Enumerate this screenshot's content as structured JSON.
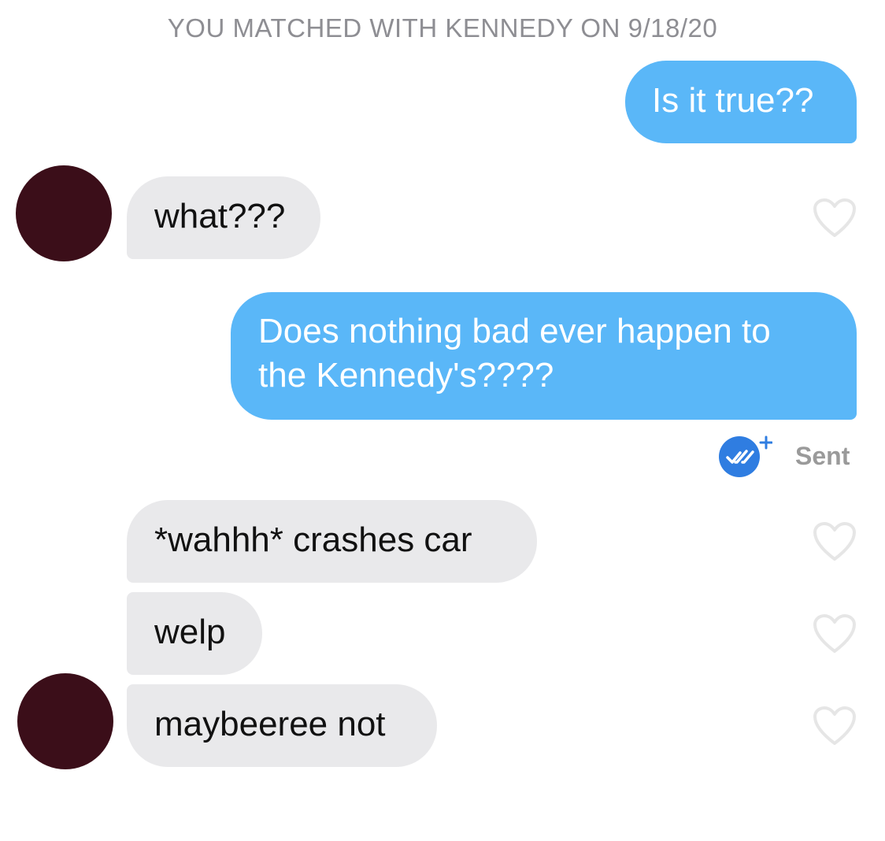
{
  "header": {
    "match_text": "YOU MATCHED WITH KENNEDY ON 9/18/20"
  },
  "messages": [
    {
      "direction": "outgoing",
      "text": "Is it true??"
    },
    {
      "direction": "incoming",
      "text": "what???"
    },
    {
      "direction": "outgoing",
      "line1": "Does nothing bad ever happen to",
      "line2": "the Kennedy's????"
    },
    {
      "direction": "incoming",
      "text": "*wahhh* crashes car"
    },
    {
      "direction": "incoming",
      "text": "welp"
    },
    {
      "direction": "incoming",
      "text": "maybeeree not"
    }
  ],
  "delivery_status": {
    "text": "Sent",
    "icon": "read-receipt-icon"
  },
  "icons": {
    "like": "heart-outline-icon",
    "avatar": "redacted-avatar"
  },
  "colors": {
    "outgoing_bubble": "#5ab7f8",
    "incoming_bubble": "#e9e9eb",
    "avatar_redaction": "#3b0e19",
    "receipt_badge": "#2f7de1",
    "header_text": "#8e8e93"
  }
}
